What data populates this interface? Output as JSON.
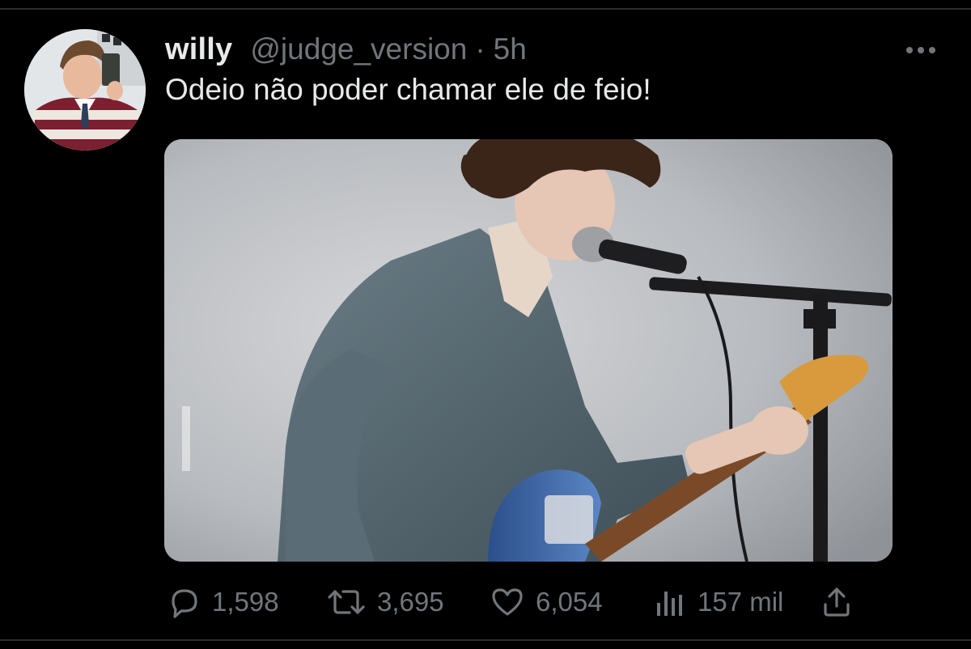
{
  "tweet": {
    "display_name": "willy",
    "handle": "@judge_version",
    "separator": "·",
    "time": "5h",
    "text": "Odeio não poder chamar ele de feio!",
    "avatar_icon": "profile-photo",
    "media_icon": "photo-of-guitarist-singing"
  },
  "actions": {
    "reply_count": "1,598",
    "retweet_count": "3,695",
    "like_count": "6,054",
    "views_count": "157 mil",
    "reply_icon": "reply-icon",
    "retweet_icon": "retweet-icon",
    "like_icon": "heart-icon",
    "views_icon": "views-icon",
    "share_icon": "share-icon",
    "more_icon": "more-icon"
  },
  "colors": {
    "background": "#000000",
    "primary_text": "#e7e9ea",
    "secondary_text": "#71767b",
    "divider": "#2b2d30"
  }
}
